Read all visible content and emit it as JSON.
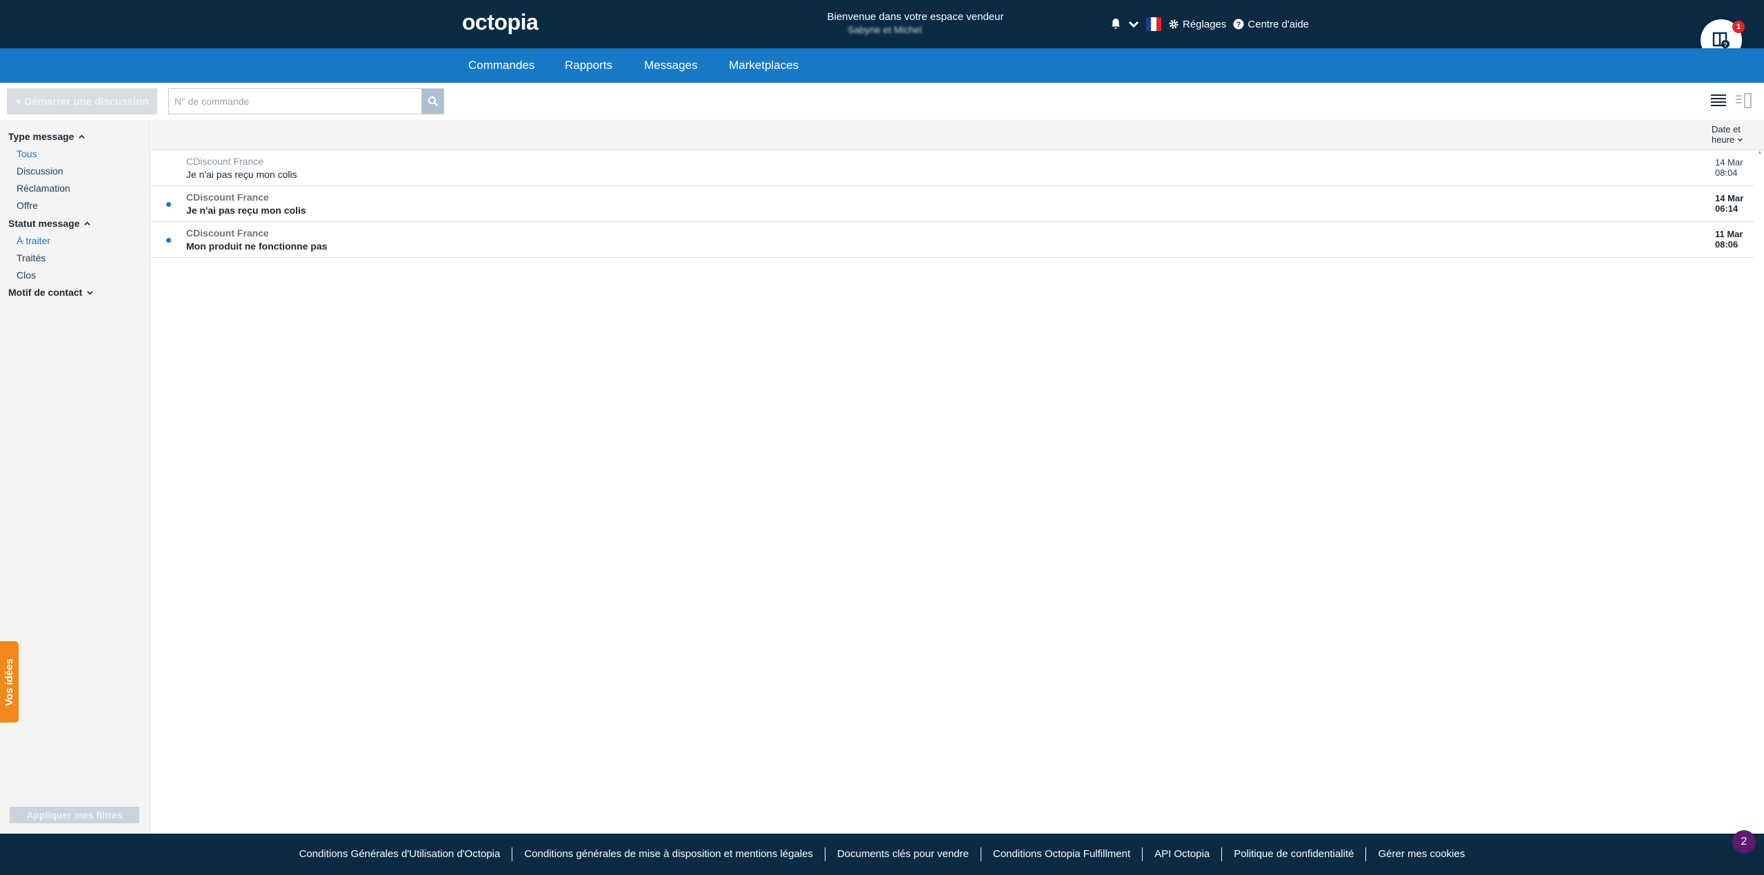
{
  "header": {
    "logo": "octopia",
    "welcome": "Bienvenue dans votre espace vendeur",
    "vendor_name": "Sabyne et Michel",
    "settings_label": "Réglages",
    "help_label": "Centre d'aide",
    "help_badge": "1"
  },
  "nav": {
    "items": [
      "Commandes",
      "Rapports",
      "Messages",
      "Marketplaces"
    ]
  },
  "toolbar": {
    "start_discussion": "+ Démarrer une discussion",
    "search_placeholder": "N° de commande"
  },
  "sidebar": {
    "type_group": "Type message",
    "type_items": [
      "Tous",
      "Discussion",
      "Réclamation",
      "Offre"
    ],
    "status_group": "Statut message",
    "status_items": [
      "À traiter",
      "Traités",
      "Clos"
    ],
    "motif_group": "Motif de contact",
    "apply_button": "Appliquer mes filtres",
    "ideas_tab": "Vos idées"
  },
  "list": {
    "sort_label_1": "Date et",
    "sort_label_2": "heure",
    "rows": [
      {
        "from": "CDiscount France",
        "subject": "Je n'ai pas reçu mon colis",
        "date": "14 Mar",
        "time": "08:04",
        "unread": false
      },
      {
        "from": "CDiscount France",
        "subject": "Je n'ai pas reçu mon colis",
        "date": "14 Mar",
        "time": "06:14",
        "unread": true
      },
      {
        "from": "CDiscount France",
        "subject": "Mon produit ne fonctionne pas",
        "date": "11 Mar",
        "time": "08:06",
        "unread": true
      }
    ]
  },
  "footer": {
    "links": [
      "Conditions Générales d'Utilisation d'Octopia",
      "Conditions générales de mise à disposition et mentions légales",
      "Documents clés pour vendre",
      "Conditions Octopia Fulfillment",
      "API Octopia",
      "Politique de confidentialité",
      "Gérer mes cookies"
    ],
    "chat_badge": "2"
  },
  "colors": {
    "header_bg": "#0b2a43",
    "nav_bg": "#1778c6",
    "accent": "#1778c6",
    "ideas_tab": "#f0891a"
  },
  "icons": [
    "bell-icon",
    "chevron-down-icon",
    "flag-fr-icon",
    "gear-icon",
    "help-circle-icon",
    "search-icon",
    "list-view-icon",
    "split-view-icon",
    "chevron-up-icon",
    "help-book-icon",
    "chat-icon"
  ]
}
